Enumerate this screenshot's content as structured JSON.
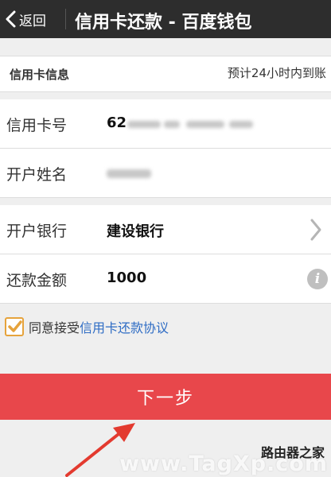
{
  "header": {
    "back_label": "返回",
    "title": "信用卡还款 - 百度钱包"
  },
  "section": {
    "title": "信用卡信息",
    "note": "预计24小时内到账"
  },
  "fields": {
    "card_number": {
      "label": "信用卡号",
      "value_prefix": "62"
    },
    "holder_name": {
      "label": "开户姓名"
    },
    "bank": {
      "label": "开户银行",
      "value": "建设银行"
    },
    "amount": {
      "label": "还款金额",
      "value": "1000"
    }
  },
  "agreement": {
    "checked": true,
    "prefix": "同意接受",
    "link": "信用卡还款协议"
  },
  "next_button": {
    "label": "下一步"
  },
  "watermark": {
    "top": "路由器之家",
    "main": "www.TagXp.com"
  },
  "colors": {
    "header_bg": "#2d2d2d",
    "button_bg": "#e8474b",
    "link": "#2e6cc4",
    "checkbox_accent": "#e6a33c",
    "arrow": "#e33a2f"
  }
}
